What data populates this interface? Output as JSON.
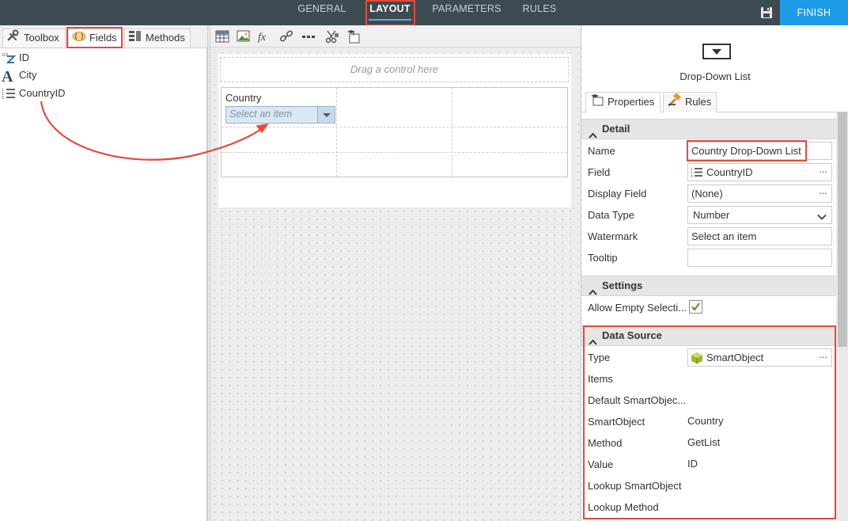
{
  "top_nav": {
    "tabs": [
      {
        "label": "GENERAL",
        "active": false
      },
      {
        "label": "LAYOUT",
        "active": true
      },
      {
        "label": "PARAMETERS",
        "active": false
      },
      {
        "label": "RULES",
        "active": false
      }
    ],
    "finish_label": "FINISH",
    "save_icon": "save-icon",
    "colors": {
      "bar": "#3e4a52",
      "finish": "#1e9be6",
      "highlight": "#e24b3c"
    }
  },
  "left_panel": {
    "tabs": [
      {
        "label": "Toolbox",
        "icon": "wrench-icon"
      },
      {
        "label": "Fields",
        "icon": "fields-icon",
        "active": true
      },
      {
        "label": "Methods",
        "icon": "methods-icon"
      }
    ],
    "fields": [
      {
        "label": "ID",
        "icon": "autonumber-icon"
      },
      {
        "label": "City",
        "icon": "text-type-icon"
      },
      {
        "label": "CountryID",
        "icon": "number-list-icon"
      }
    ]
  },
  "canvas": {
    "toolbar_icons": [
      "table-icon",
      "image-icon",
      "expression-icon",
      "link-icon",
      "separator-icon",
      "scissors-icon",
      "theme-icon"
    ],
    "drag_placeholder": "Drag a control here",
    "country_label": "Country",
    "dropdown_placeholder": "Select an item"
  },
  "properties_panel": {
    "control_type": "Drop-Down List",
    "tabs": [
      {
        "label": "Properties",
        "icon": "properties-icon",
        "active": true
      },
      {
        "label": "Rules",
        "icon": "gavel-icon"
      }
    ],
    "detail": {
      "title": "Detail",
      "name_label": "Name",
      "name_value": "Country Drop-Down List",
      "field_label": "Field",
      "field_value": "CountryID",
      "display_field_label": "Display Field",
      "display_field_value": "(None)",
      "data_type_label": "Data Type",
      "data_type_value": "Number",
      "watermark_label": "Watermark",
      "watermark_value": "Select an item",
      "tooltip_label": "Tooltip",
      "tooltip_value": ""
    },
    "settings": {
      "title": "Settings",
      "allow_empty_label": "Allow Empty Selecti...",
      "allow_empty_checked": true
    },
    "data_source": {
      "title": "Data Source",
      "type_label": "Type",
      "type_value": "SmartObject",
      "items_label": "Items",
      "default_label": "Default SmartObjec...",
      "smartobject_label": "SmartObject",
      "smartobject_value": "Country",
      "method_label": "Method",
      "method_value": "GetList",
      "value_label": "Value",
      "value_value": "ID",
      "lookup_so_label": "Lookup SmartObject",
      "lookup_method_label": "Lookup Method"
    }
  }
}
